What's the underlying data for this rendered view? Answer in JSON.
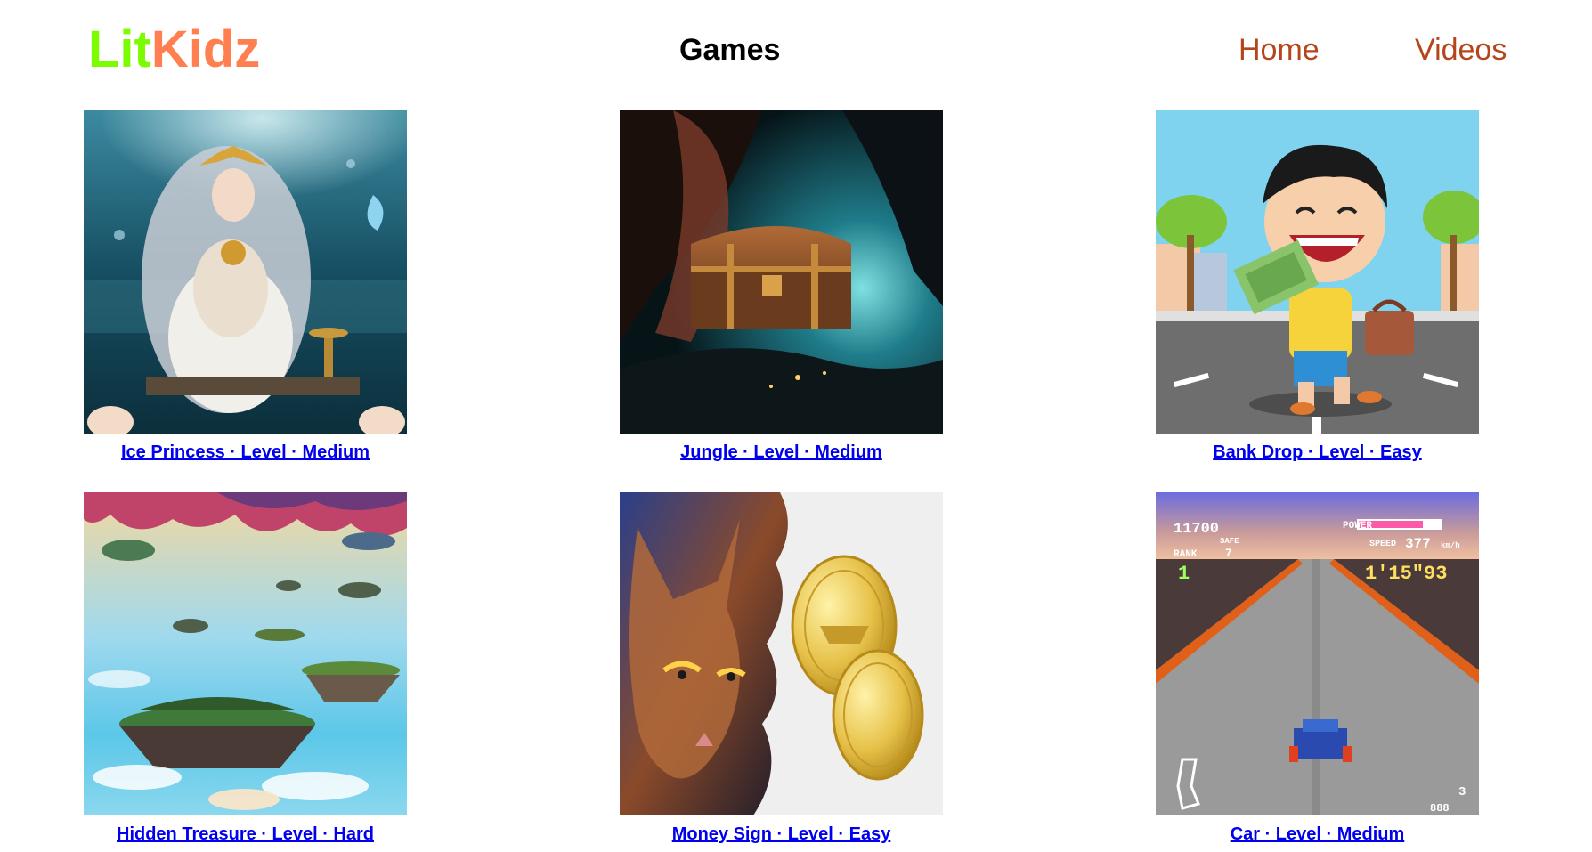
{
  "header": {
    "logo_part1": "Lit",
    "logo_part2": "Kidz",
    "page_title": "Games",
    "nav": [
      {
        "label": "Home"
      },
      {
        "label": "Videos"
      }
    ]
  },
  "colors": {
    "logo_lit": "#7cfc00",
    "logo_kidz": "#ff7f50",
    "nav_link": "#b5461c",
    "card_link": "#0000ee"
  },
  "games": [
    {
      "caption": "Ice Princess · Level · Medium",
      "image": "underwater-princess-image"
    },
    {
      "caption": "Jungle · Level · Medium",
      "image": "treasure-chest-cave-image"
    },
    {
      "caption": "Bank Drop · Level · Easy",
      "image": "cartoon-boy-money-image"
    },
    {
      "caption": "Hidden Treasure · Level · Hard",
      "image": "floating-islands-image"
    },
    {
      "caption": "Money Sign · Level · Easy",
      "image": "cat-and-coins-image"
    },
    {
      "caption": "Car · Level · Medium",
      "image": "racing-game-image"
    }
  ],
  "race_hud": {
    "score": "11700",
    "power_label": "POWER",
    "safe_label": "SAFE",
    "rank_label": "RANK",
    "rank_total": "7",
    "rank_value": "1",
    "speed_label": "SPEED",
    "speed_value": "377",
    "speed_unit": "km/h",
    "lap_time": "1'15\"93",
    "lives": "3",
    "bottom_digits": "888"
  }
}
